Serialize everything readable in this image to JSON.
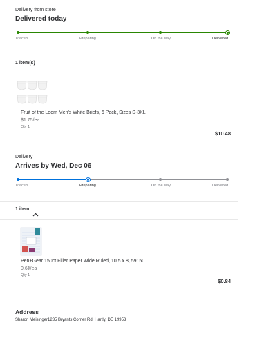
{
  "order1": {
    "kicker": "Delivery from store",
    "status_title": "Delivered today",
    "progress_color": "#2a8703",
    "steps": [
      "Placed",
      "Preparing",
      "On the way",
      "Delivered"
    ],
    "current_step": 3,
    "item_count": "1 item(s)",
    "item": {
      "image": "white-briefs-product-image",
      "name": "Fruit of the Loom Men's White Briefs, 6 Pack, Sizes S-3XL",
      "unit_price": "$1.75/ea",
      "qty": "Qty 1",
      "total": "$10.48"
    }
  },
  "order2": {
    "kicker": "Delivery",
    "status_title": "Arrives by Wed, Dec 06",
    "progress_color": "#0071dc",
    "steps": [
      "Placed",
      "Preparing",
      "On the way",
      "Delivered"
    ],
    "current_step": 1,
    "item_count": "1 item",
    "collapse_icon": "chevron-up-icon",
    "item": {
      "image": "filler-paper-product-image",
      "name": "Pen+Gear 150ct Filler Paper Wide Ruled, 10.5 x 8, 59150",
      "unit_price": "0.6¢/ea",
      "qty": "Qty 1",
      "total": "$0.84"
    }
  },
  "address": {
    "title": "Address",
    "line": "Sharon Meisinger1235 Bryants Corner Rd, Hartly, DE 19953"
  }
}
